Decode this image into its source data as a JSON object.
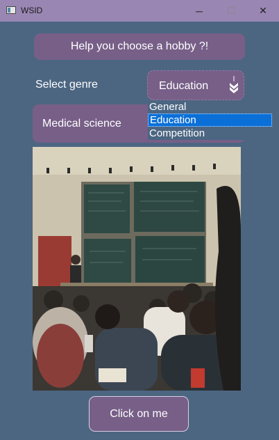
{
  "window": {
    "title": "WSID",
    "controls": {
      "minimize": "─",
      "maximize": "☐",
      "close": "✕"
    }
  },
  "header": {
    "label": "Help you choose a hobby ?!"
  },
  "genre": {
    "label": "Select genre",
    "selected": "Education",
    "options": [
      "General",
      "Education",
      "Competition"
    ]
  },
  "result": {
    "text": "Medical science"
  },
  "image": {
    "subject": "classroom-lecture-photo"
  },
  "action": {
    "label": "Click on me"
  },
  "colors": {
    "background": "#4c6682",
    "panel": "#775f88",
    "titlebar": "#9a86b3",
    "highlight": "#0a70d8"
  }
}
